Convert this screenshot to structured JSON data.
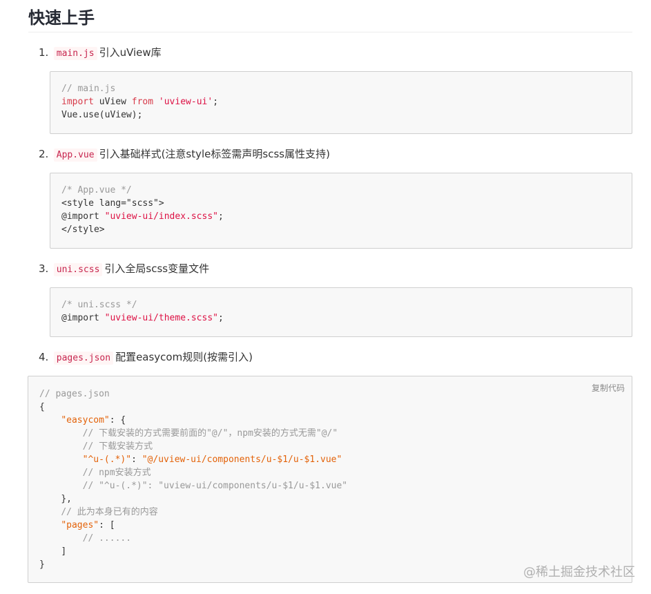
{
  "title": "快速上手",
  "steps": [
    {
      "num": "1.",
      "code": "main.js",
      "text": "引入uView库"
    },
    {
      "num": "2.",
      "code": "App.vue",
      "text": "引入基础样式(注意style标签需声明scss属性支持)"
    },
    {
      "num": "3.",
      "code": "uni.scss",
      "text": "引入全局scss变量文件"
    },
    {
      "num": "4.",
      "code": "pages.json",
      "text": "配置easycom规则(按需引入)"
    }
  ],
  "code1": {
    "l1": "// main.js",
    "l2_kw": "import",
    "l2_a": " uView ",
    "l2_kw2": "from",
    "l2_b": " ",
    "l2_str": "'uview-ui'",
    "l2_c": ";",
    "l3": "Vue.use(uView);"
  },
  "code2": {
    "l1": "/* App.vue */",
    "l2": "<style lang=\"scss\">",
    "l3_a": "@import ",
    "l3_str": "\"uview-ui/index.scss\"",
    "l3_b": ";",
    "l4": "</style>"
  },
  "code3": {
    "l1": "/* uni.scss */",
    "l2_a": "@import ",
    "l2_str": "\"uview-ui/theme.scss\"",
    "l2_b": ";"
  },
  "code4": {
    "copy_label": "复制代码",
    "l1": "// pages.json",
    "l2": "{",
    "l3_key": "\"easycom\"",
    "l3_rest": ": {",
    "l4": "// 下载安装的方式需要前面的\"@/\"，npm安装的方式无需\"@/\"",
    "l5": "// 下载安装方式",
    "l6_key": "\"^u-(.*)\"",
    "l6_mid": ": ",
    "l6_val": "\"@/uview-ui/components/u-$1/u-$1.vue\"",
    "l7": "// npm安装方式",
    "l8": "// \"^u-(.*)\": \"uview-ui/components/u-$1/u-$1.vue\"",
    "l9": "},",
    "l10": "// 此为本身已有的内容",
    "l11_key": "\"pages\"",
    "l11_rest": ": [",
    "l12": "// ......",
    "l13": "]",
    "l14": "}"
  },
  "watermark": "@稀土掘金技术社区",
  "colors": {
    "keyword": "#d73a49",
    "string": "#e36209",
    "comment": "#999999",
    "inline_code": "#c7254e"
  }
}
